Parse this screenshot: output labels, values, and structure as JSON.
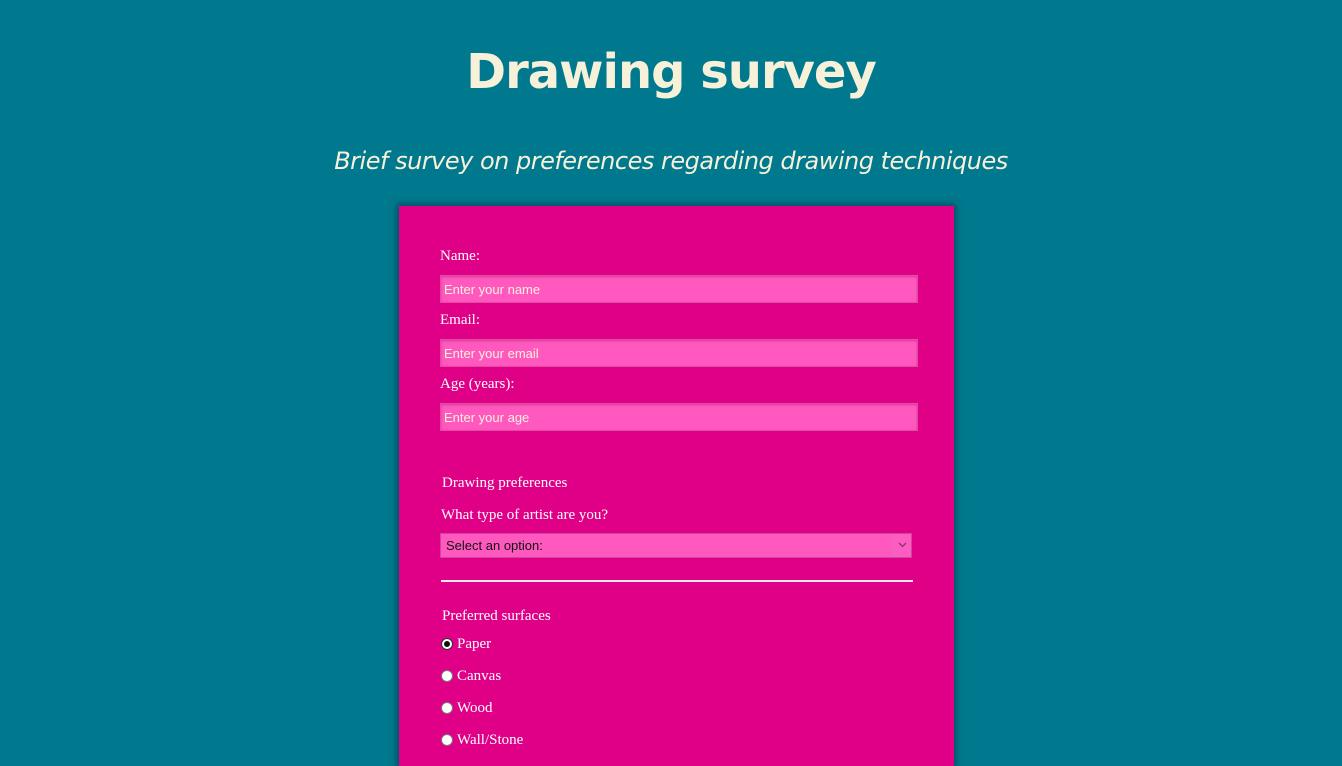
{
  "page": {
    "title": "Drawing survey",
    "description": "Brief survey on preferences regarding drawing techniques"
  },
  "colors": {
    "background": "#00788d",
    "form_background": "#df0087",
    "input_background": "#ff59bf",
    "heading_text": "#f7f1da",
    "label_text": "#ffffff"
  },
  "form": {
    "name": {
      "label": "Name:",
      "placeholder": "Enter your name",
      "value": ""
    },
    "email": {
      "label": "Email:",
      "placeholder": "Enter your email",
      "value": ""
    },
    "age": {
      "label": "Age (years):",
      "placeholder": "Enter your age",
      "value": ""
    },
    "drawing_preferences": {
      "heading": "Drawing preferences",
      "artist_type_question": "What type of artist are you?",
      "artist_type_selected": "Select an option:",
      "artist_type_icon": "chevron-down-icon"
    },
    "surfaces": {
      "heading": "Preferred surfaces",
      "options": [
        {
          "label": "Paper",
          "checked": true
        },
        {
          "label": "Canvas",
          "checked": false
        },
        {
          "label": "Wood",
          "checked": false
        },
        {
          "label": "Wall/Stone",
          "checked": false
        }
      ]
    }
  }
}
